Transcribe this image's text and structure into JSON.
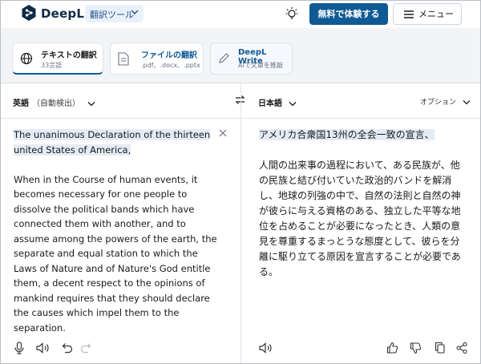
{
  "header": {
    "brand": "DeepL",
    "tool_select": "翻訳ツール",
    "try_button": "無料で体験する",
    "menu_button": "メニュー"
  },
  "modes": [
    {
      "title": "テキストの翻訳",
      "sub": "33言語"
    },
    {
      "title": "ファイルの翻訳",
      "sub": ".pdf、.docx、.pptx"
    },
    {
      "title": "DeepL Write",
      "sub": "AIで文章を推敲"
    }
  ],
  "lang_bar": {
    "source_lang": "英語",
    "source_detect": "（自動検出）",
    "target_lang": "日本語",
    "options": "オプション"
  },
  "source": {
    "title_line": "The unanimous Declaration of the thirteen united States of America,",
    "body": "When in the Course of human events, it becomes necessary for one people to dissolve the political bands which have connected them with another, and to assume among the powers of the earth, the separate and equal station to which the Laws of Nature and of Nature's God entitle them, a decent respect to the opinions of mankind requires that they should declare the causes which impel them to the separation."
  },
  "target": {
    "title_line": "アメリカ合衆国13州の全会一致の宣言、",
    "body": "人間の出来事の過程において、ある民族が、他の民族と結び付いていた政治的バンドを解消し、地球の列強の中で、自然の法則と自然の神が彼らに与える資格のある、独立した平等な地位を占めることが必要になったとき、人類の意見を尊重するまっとうな態度として、彼らを分離に駆り立てる原因を宣言することが必要である。"
  },
  "colors": {
    "accent": "#0f5a95",
    "highlight": "#e3ecf6",
    "mode_bg": "#f2f4f6"
  }
}
